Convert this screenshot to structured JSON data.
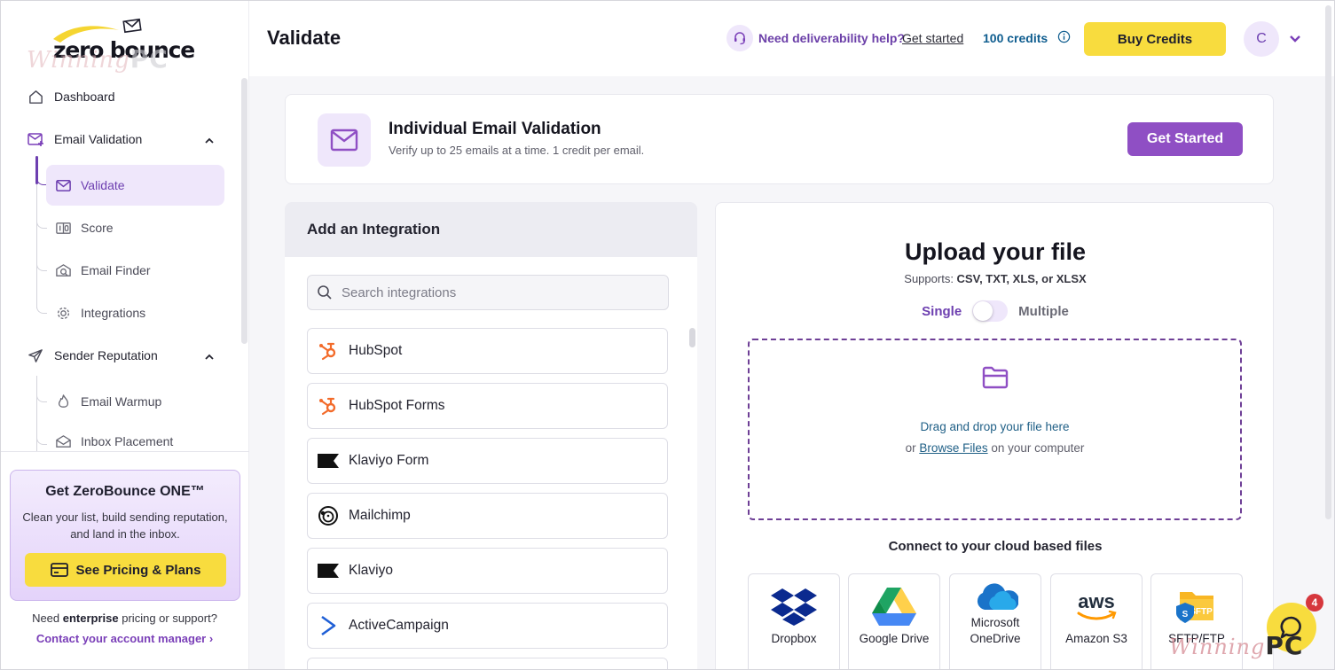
{
  "brand": {
    "logo_text": "zero bounce",
    "watermark_script": "Winning",
    "watermark_pc": "PC"
  },
  "sidebar": {
    "dashboard": "Dashboard",
    "email_validation": "Email Validation",
    "sub_validation": [
      "Validate",
      "Score",
      "Email Finder",
      "Integrations"
    ],
    "sender_reputation": "Sender Reputation",
    "sub_sender": [
      "Email Warmup",
      "Inbox Placement"
    ],
    "promo": {
      "title": "Get ZeroBounce ONE™",
      "text": "Clean your list, build sending reputation, and land in the inbox.",
      "button": "See Pricing & Plans"
    },
    "enterprise_prefix": "Need ",
    "enterprise_bold": "enterprise",
    "enterprise_suffix": " pricing or support?",
    "contact": "Contact your account manager ›"
  },
  "header": {
    "title": "Validate",
    "help_text": "Need deliverability help?",
    "help_link": "Get started",
    "credits": "100 credits",
    "buy_button": "Buy Credits",
    "avatar": "C"
  },
  "hero": {
    "title": "Individual Email Validation",
    "subtitle": "Verify up to 25 emails at a time. 1 credit per email.",
    "button": "Get Started"
  },
  "integrations": {
    "title": "Add an Integration",
    "search_placeholder": "Search integrations",
    "items": [
      "HubSpot",
      "HubSpot Forms",
      "Klaviyo Form",
      "Mailchimp",
      "Klaviyo",
      "ActiveCampaign"
    ]
  },
  "upload": {
    "title": "Upload your file",
    "supports_label": "Supports: ",
    "supports_formats": "CSV, TXT, XLS, or XLSX",
    "toggle_single": "Single",
    "toggle_multiple": "Multiple",
    "drop_line1": "Drag and drop your file here",
    "drop_line2_prefix": "or ",
    "drop_link": "Browse Files",
    "drop_line2_suffix": " on your computer",
    "cloud_title": "Connect to your cloud based files",
    "cloud": [
      "Dropbox",
      "Google Drive",
      "Microsoft OneDrive",
      "Amazon S3",
      "SFTP/FTP"
    ]
  },
  "chat": {
    "badge": "4"
  },
  "colors": {
    "accent_purple": "#8f4fc4",
    "accent_yellow": "#f8dc3e",
    "link_blue": "#1f5f86",
    "hubspot_orange": "#f36b2a"
  }
}
